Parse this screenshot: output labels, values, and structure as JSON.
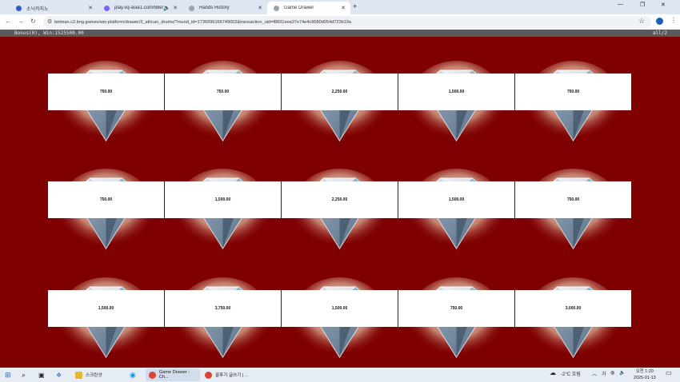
{
  "browser": {
    "tabs": [
      {
        "title": "소닉카지노",
        "color": "#2b5bd7",
        "active": false
      },
      {
        "title": "play.vq-asia1.com/68e5c0",
        "color": "#7b61ff",
        "active": false
      },
      {
        "title": "Hands History",
        "color": "#555555",
        "active": false
      },
      {
        "title": "Game Drawer",
        "color": "#555555",
        "active": true
      }
    ],
    "url": "betman.c2.bng.games/wix-platform/drawer/3_african_drums/?round_id=1736696166749002&transaction_uid=f8831eea37e74e4c9680d054d723b19a"
  },
  "game": {
    "status_left": "Bonus(0), Win:1525500.00",
    "status_right": "all/2",
    "colors": {
      "background": "#7e0000",
      "status_bar": "#5a5a5a",
      "card": "#ffffff"
    },
    "rows": [
      [
        "750.00",
        "750.00",
        "2,250.00",
        "1,500.00",
        "750.00"
      ],
      [
        "750.00",
        "1,500.00",
        "2,250.00",
        "1,500.00",
        "750.00"
      ],
      [
        "1,500.00",
        "3,750.00",
        "1,500.00",
        "750.00",
        "3,000.00"
      ]
    ]
  },
  "taskbar": {
    "apps": [
      {
        "label": "스크린샷",
        "active": false,
        "color": "#e8b630"
      },
      {
        "label": "Game Drawer - Ch...",
        "active": true,
        "color": "#db4437"
      },
      {
        "label": "꿀후기 글쓰기 | ...",
        "active": false,
        "color": "#db4437"
      }
    ],
    "weather": "-2°C 흐림",
    "ime": "가",
    "time": "오전 1:20",
    "date": "2025-01-13"
  }
}
